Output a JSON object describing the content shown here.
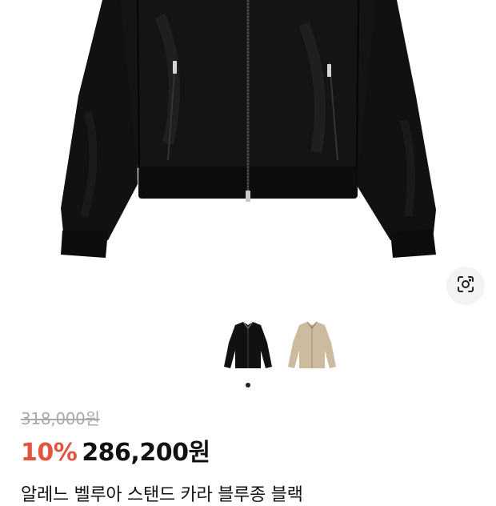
{
  "product": {
    "original_price": "318,000원",
    "discount": "10%",
    "sale_price": "286,200원",
    "title": "알레느 벨루아 스탠드 카라 블루종 블랙"
  },
  "gallery": {
    "thumbnails": [
      {
        "color_name": "black",
        "hex": "#111111",
        "selected": true
      },
      {
        "color_name": "beige",
        "hex": "#cdbba0",
        "selected": false
      }
    ],
    "page_dots": 1
  },
  "icons": {
    "image_search": "camera-lens-icon"
  },
  "colors": {
    "discount": "#e3533f",
    "text": "#111111",
    "muted": "#a9a9a9"
  }
}
